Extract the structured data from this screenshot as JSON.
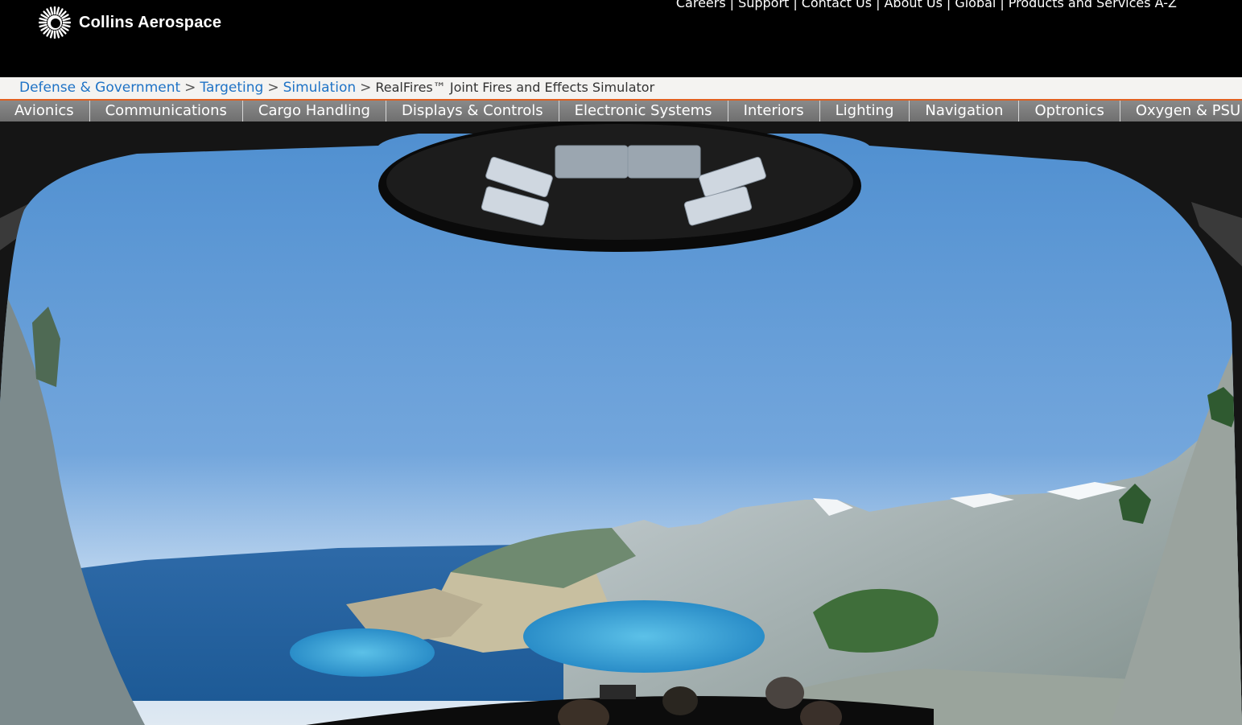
{
  "brand": {
    "name": "Collins Aerospace"
  },
  "utility_nav": {
    "items": [
      "Careers",
      "Support",
      "Contact Us",
      "About Us",
      "Global",
      "Products and Services A-Z"
    ],
    "separator": "|"
  },
  "breadcrumb": {
    "items": [
      "Defense & Government",
      "Targeting",
      "Simulation"
    ],
    "separator": ">",
    "current": "RealFires™ Joint Fires and Effects Simulator"
  },
  "product_nav": {
    "items": [
      "Avionics",
      "Communications",
      "Cargo Handling",
      "Displays & Controls",
      "Electronic Systems",
      "Interiors",
      "Lighting",
      "Navigation",
      "Optronics",
      "Oxygen & PSU"
    ]
  },
  "colors": {
    "link_blue": "#1f73c6",
    "accent_orange": "#e06020",
    "header_black": "#000000",
    "nav_gray": "#7a7a7a"
  }
}
